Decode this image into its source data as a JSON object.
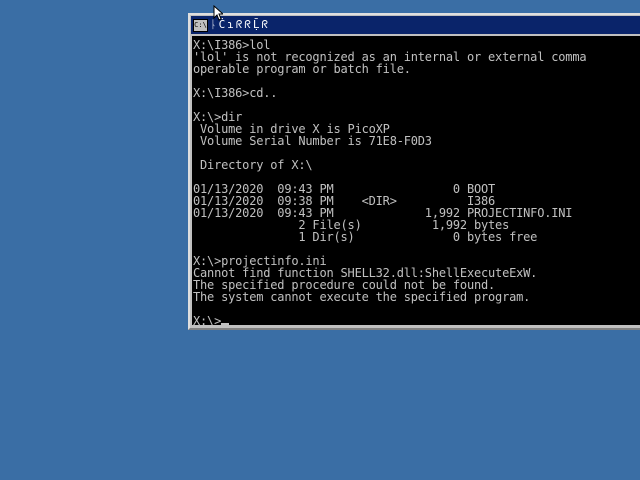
{
  "console": {
    "titlebar_glyphs": [
      "ᚿ",
      "Ċ",
      "ɿ",
      "ᖇ",
      "ᖇ",
      "Ḹ",
      "ᖇ"
    ],
    "system_menu_icon": "cmd-icon",
    "lines": [
      "X:\\I386>lol",
      "'lol' is not recognized as an internal or external comma",
      "operable program or batch file.",
      "",
      "X:\\I386>cd..",
      "",
      "X:\\>dir",
      " Volume in drive X is PicoXP",
      " Volume Serial Number is 71E8-F0D3",
      "",
      " Directory of X:\\",
      "",
      "01/13/2020  09:43 PM                 0 BOOT",
      "01/13/2020  09:38 PM    <DIR>          I386",
      "01/13/2020  09:43 PM             1,992 PROJECTINFO.INI",
      "               2 File(s)          1,992 bytes",
      "               1 Dir(s)              0 bytes free",
      "",
      "X:\\>projectinfo.ini",
      "Cannot find function SHELL32.dll:ShellExecuteExW.",
      "The specified procedure could not be found.",
      "The system cannot execute the specified program.",
      "",
      "X:\\>"
    ]
  },
  "colors": {
    "desktop": "#3a6ea5",
    "titlebar": "#0a246a",
    "console_bg": "#000000",
    "console_text": "#c0c0c0"
  },
  "pointer_icon": "arrow-pointer-icon"
}
